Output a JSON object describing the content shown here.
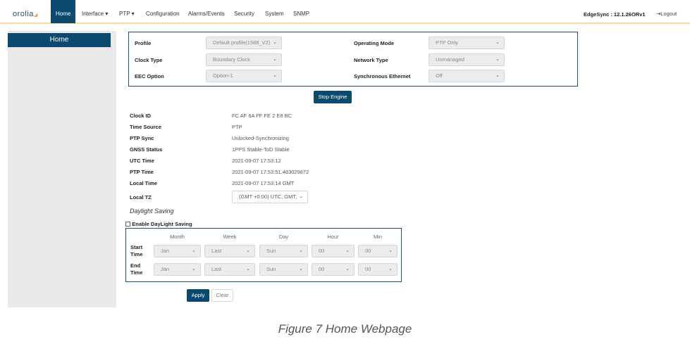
{
  "nav": {
    "logo": "orolia",
    "items": [
      "Home",
      "Interface ▾",
      "PTP ▾",
      "Configuration",
      "Alarms/Events",
      "Security",
      "System",
      "SNMP"
    ],
    "version": "EdgeSync : 12.1.26ORv1",
    "logout": "Logout"
  },
  "sidebar": {
    "title": "Home"
  },
  "config": {
    "profile": {
      "label": "Profile",
      "value": "Default profile(1588_V2)"
    },
    "clock_type": {
      "label": "Clock Type",
      "value": "Boundary Clock"
    },
    "eec_option": {
      "label": "EEC Option",
      "value": "Option-1"
    },
    "operating_mode": {
      "label": "Operating Mode",
      "value": "PTP Only"
    },
    "network_type": {
      "label": "Network Type",
      "value": "Unmanaged"
    },
    "sync_ethernet": {
      "label": "Synchronous Ethernet",
      "value": "Off"
    }
  },
  "stop_engine": "Stop Engine",
  "status": [
    {
      "label": "Clock ID",
      "value": "FC AF 6A FF FE 2 E8 BC"
    },
    {
      "label": "Time Source",
      "value": "PTP"
    },
    {
      "label": "PTP Sync",
      "value": "Unlocked-Synchronizing"
    },
    {
      "label": "GNSS Status",
      "value": "1PPS Stable-ToD Stable"
    },
    {
      "label": "UTC Time",
      "value": "2021-09-07 17:53:12"
    },
    {
      "label": "PTP Time",
      "value": "2021-09-07 17:53:51.483029872"
    },
    {
      "label": "Local Time",
      "value": "2021-09-07 17:53:14 GMT"
    }
  ],
  "local_tz": {
    "label": "Local TZ",
    "value": "(GMT +0:00) UTC, GMT,"
  },
  "daylight": {
    "title": "Daylight Saving",
    "enable_label": "Enable DayLight Saving",
    "enabled": false,
    "columns": [
      "Month",
      "Week",
      "Day",
      "Hour",
      "Min"
    ],
    "rows": [
      {
        "label": "Start Time",
        "values": [
          "Jan",
          "Last",
          "Sun",
          "00",
          "00"
        ]
      },
      {
        "label": "End Time",
        "values": [
          "Jan",
          "Last",
          "Sun",
          "00",
          "00"
        ]
      }
    ]
  },
  "apply": "Apply",
  "clear": "Clear",
  "caption": "Figure 7 Home Webpage"
}
